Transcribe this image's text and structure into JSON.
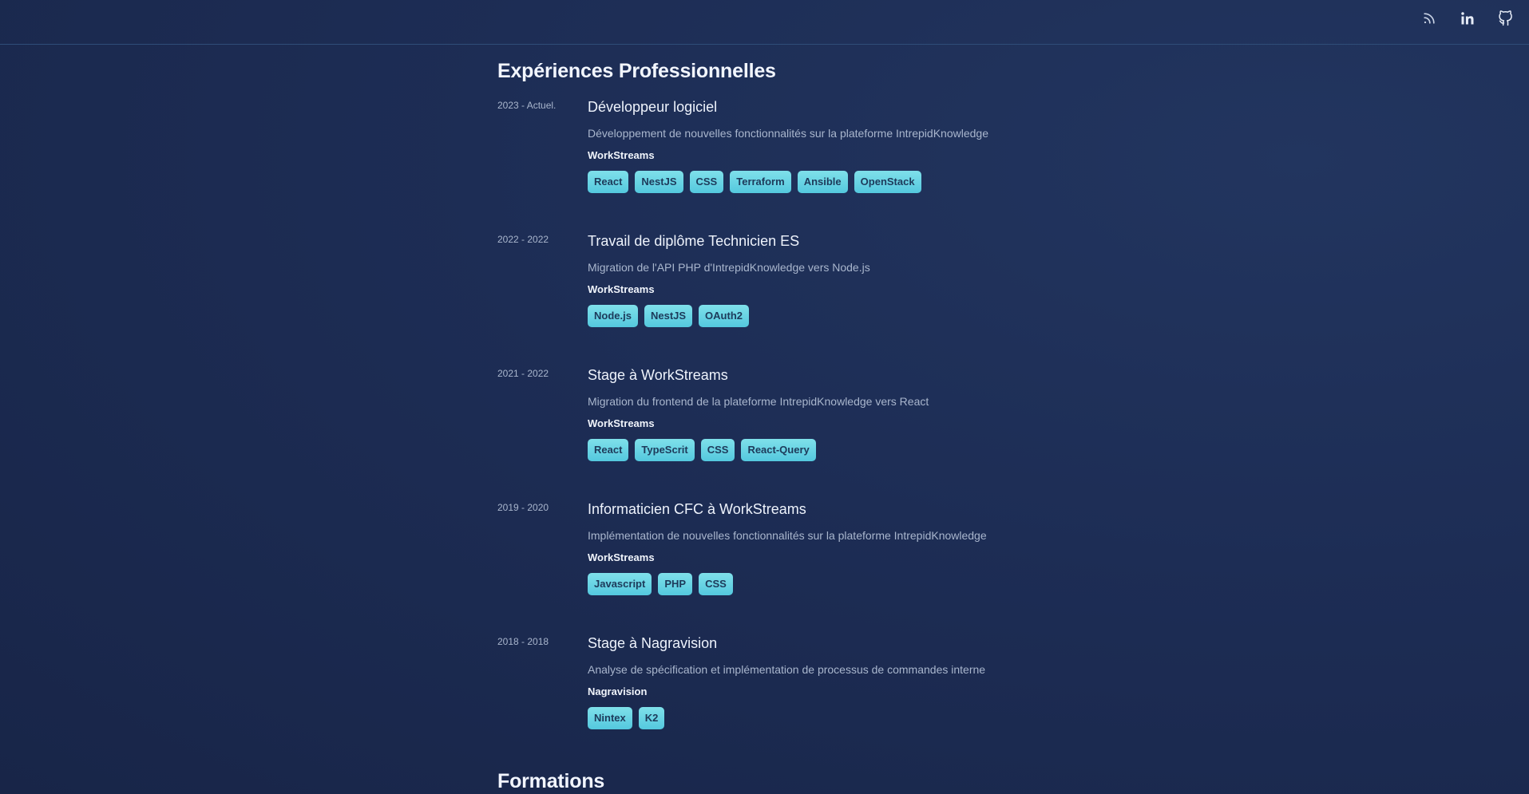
{
  "header": {
    "icons": [
      "rss-icon",
      "linkedin-icon",
      "github-icon"
    ]
  },
  "experiences_section": {
    "title": "Expériences Professionnelles",
    "items": [
      {
        "period": "2023 - Actuel.",
        "title": "Développeur logiciel",
        "description": "Développement de nouvelles fonctionnalités sur la plateforme IntrepidKnowledge",
        "company": "WorkStreams",
        "tags": [
          "React",
          "NestJS",
          "CSS",
          "Terraform",
          "Ansible",
          "OpenStack"
        ]
      },
      {
        "period": "2022 - 2022",
        "title": "Travail de diplôme Technicien ES",
        "description": "Migration de l'API PHP d'IntrepidKnowledge vers Node.js",
        "company": "WorkStreams",
        "tags": [
          "Node.js",
          "NestJS",
          "OAuth2"
        ]
      },
      {
        "period": "2021 - 2022",
        "title": "Stage à WorkStreams",
        "description": "Migration du frontend de la plateforme IntrepidKnowledge vers React",
        "company": "WorkStreams",
        "tags": [
          "React",
          "TypeScrit",
          "CSS",
          "React-Query"
        ]
      },
      {
        "period": "2019 - 2020",
        "title": "Informaticien CFC à WorkStreams",
        "description": "Implémentation de nouvelles fonctionnalités sur la plateforme IntrepidKnowledge",
        "company": "WorkStreams",
        "tags": [
          "Javascript",
          "PHP",
          "CSS"
        ]
      },
      {
        "period": "2018 - 2018",
        "title": "Stage à Nagravision",
        "description": "Analyse de spécification et implémentation de processus de commandes interne",
        "company": "Nagravision",
        "tags": [
          "Nintex",
          "K2"
        ]
      }
    ]
  },
  "formations_section": {
    "title": "Formations"
  }
}
